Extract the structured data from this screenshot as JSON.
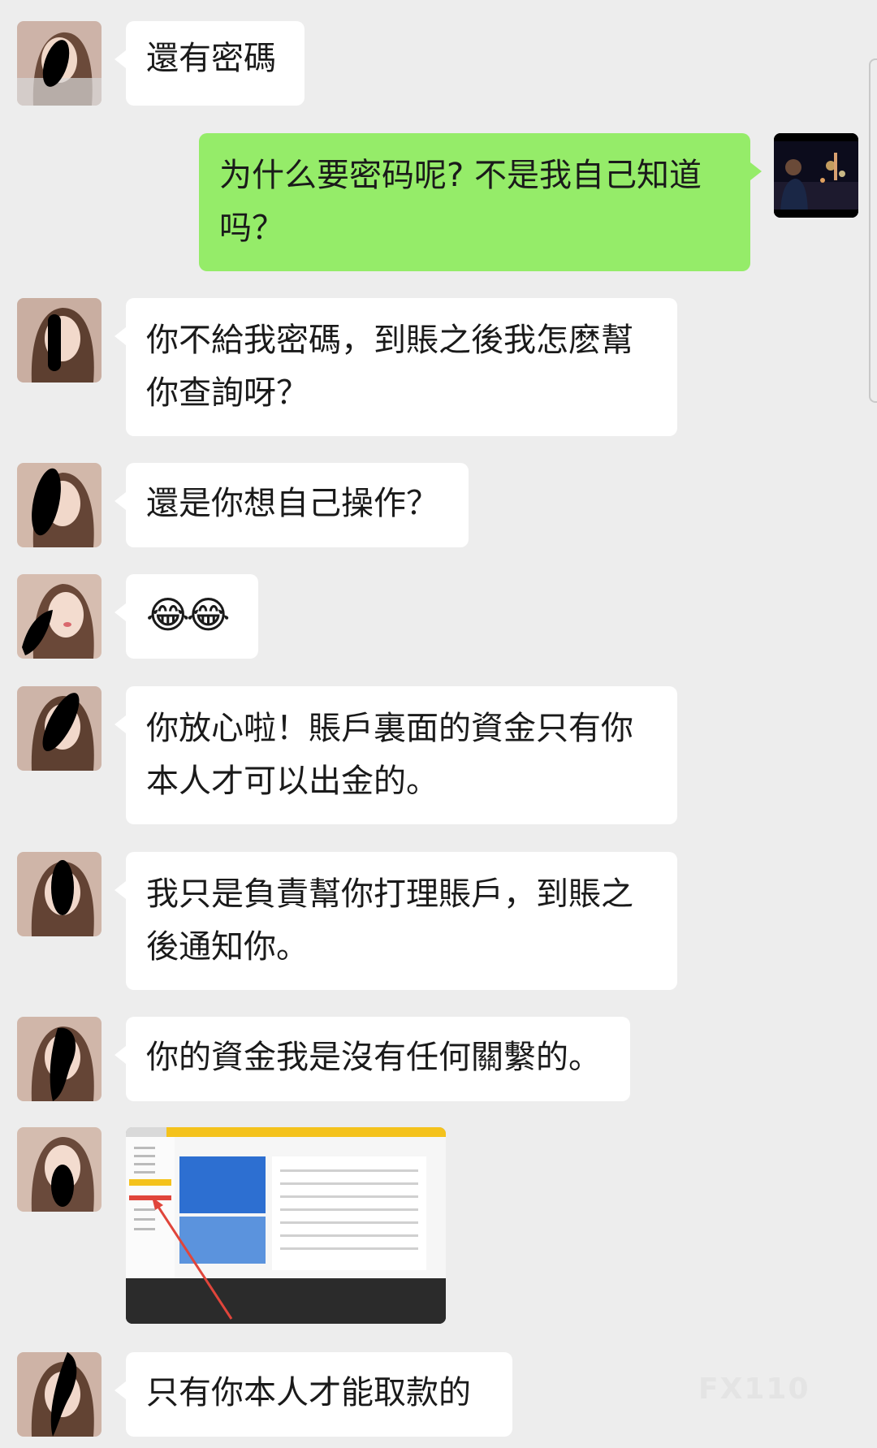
{
  "messages": [
    {
      "side": "left",
      "text": "還有密碼"
    },
    {
      "side": "right",
      "text": "为什么要密码呢? 不是我自己知道\n吗？"
    },
    {
      "side": "left",
      "text": "你不給我密碼，到賬之後我怎麽幫\n你查詢呀？"
    },
    {
      "side": "left",
      "text": "還是你想自己操作？"
    },
    {
      "side": "left",
      "text": "😂😂"
    },
    {
      "side": "left",
      "text": "你放心啦！賬戶裏面的資金只有你\n本人才可以出金的。"
    },
    {
      "side": "left",
      "text": "我只是負責幫你打理賬戶，到賬之\n後通知你。"
    },
    {
      "side": "left",
      "text": "你的資金我是沒有任何關繫的。"
    },
    {
      "side": "left",
      "type": "image",
      "image_icon": "screenshot-image-icon"
    },
    {
      "side": "left",
      "text": "只有你本人才能取款的"
    }
  ],
  "watermark": "FX110",
  "colors": {
    "background": "#ededed",
    "bubble_left": "#ffffff",
    "bubble_right": "#95ec69"
  }
}
